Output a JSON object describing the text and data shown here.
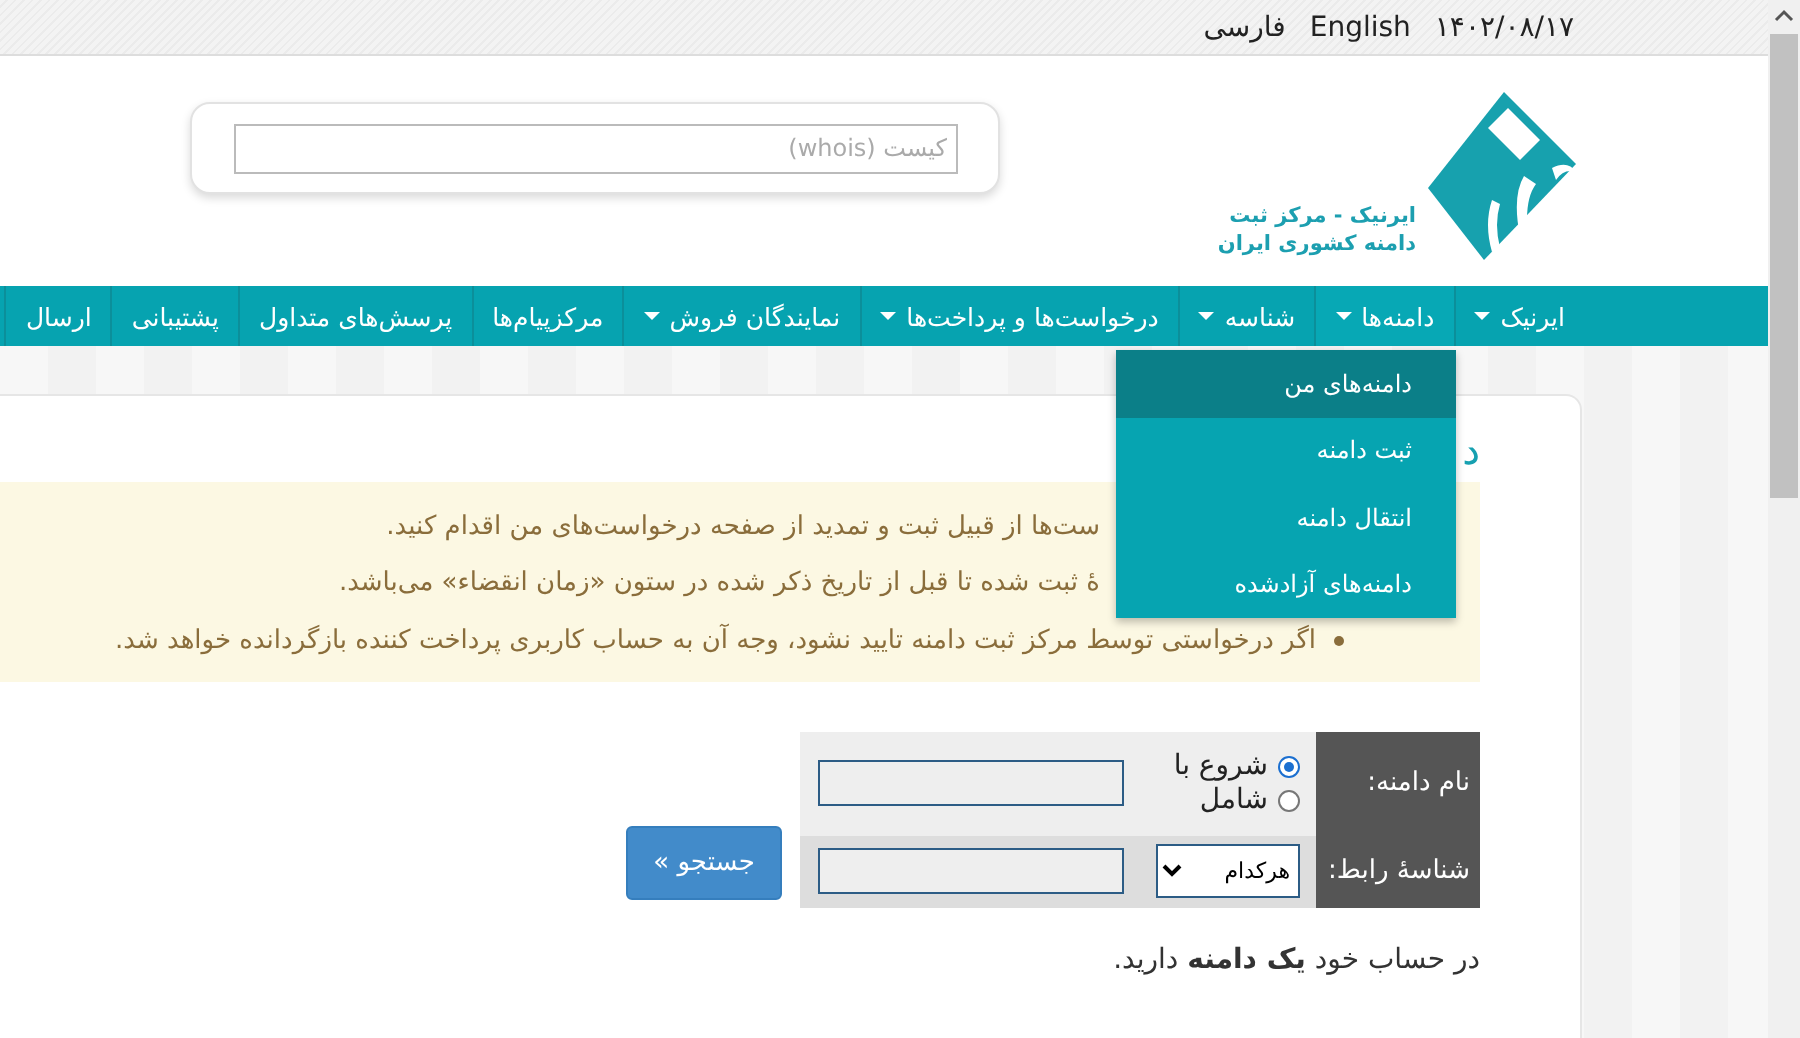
{
  "top_bar": {
    "date": "۱۴۰۲/۰۸/۱۷",
    "links": [
      "English",
      "فارسی"
    ]
  },
  "header": {
    "whois_search": {
      "placeholder": "کیست (whois)"
    },
    "logo": {
      "lines": [
        "ایرنیک - مرکز ثبت",
        "دامنه کشوری ایران"
      ]
    }
  },
  "nav": [
    {
      "label": "ایرنیک",
      "has_menu": true
    },
    {
      "label": "دامنه‌ها",
      "has_menu": true,
      "menu": [
        {
          "label": "دامنه‌های من",
          "selected": true
        },
        {
          "label": "ثبت دامنه",
          "selected": false
        },
        {
          "label": "انتقال دامنه",
          "selected": false
        },
        {
          "label": "دامنه‌های آزادشده",
          "selected": false
        }
      ]
    },
    {
      "label": "شناسه",
      "has_menu": true
    },
    {
      "label": "درخواست‌ها و پرداخت‌ها",
      "has_menu": true
    },
    {
      "label": "نمایندگان فروش",
      "has_menu": true
    },
    {
      "label": "مرکزپیام‌ها",
      "has_menu": false
    },
    {
      "label": "پرسش‌های متداول",
      "has_menu": false
    },
    {
      "label": "پشتیبانی",
      "has_menu": false
    },
    {
      "label": "ارسال",
      "has_menu": false
    }
  ],
  "content": {
    "heading": "د",
    "notice": [
      {
        "text": "ست‌ها از قبیل ثبت و تمدید از صفحه درخواست‌های من اقدام کنید.",
        "bullet": false
      },
      {
        "text": "ۀ ثبت شده تا قبل از تاریخ ذکر شده در ستون «زمان انقضاء» می‌باشد.",
        "bullet": false
      },
      {
        "text": "اگر درخواستی توسط مرکز ثبت دامنه تایید نشود، وجه آن به حساب کاربری پرداخت کننده بازگردانده خواهد شد.",
        "bullet": true
      }
    ],
    "search_form": {
      "rows": [
        {
          "label": "نام دامنه:",
          "kind": "radio",
          "options": [
            {
              "label": "شروع با",
              "selected": true
            },
            {
              "label": "شامل",
              "selected": false
            }
          ]
        },
        {
          "label": "شناسۀ رابط:",
          "kind": "select",
          "value": "هرکدام"
        }
      ],
      "button": "جستجو »"
    },
    "summary": "در حساب خود **یک دامنه** دارید."
  }
}
